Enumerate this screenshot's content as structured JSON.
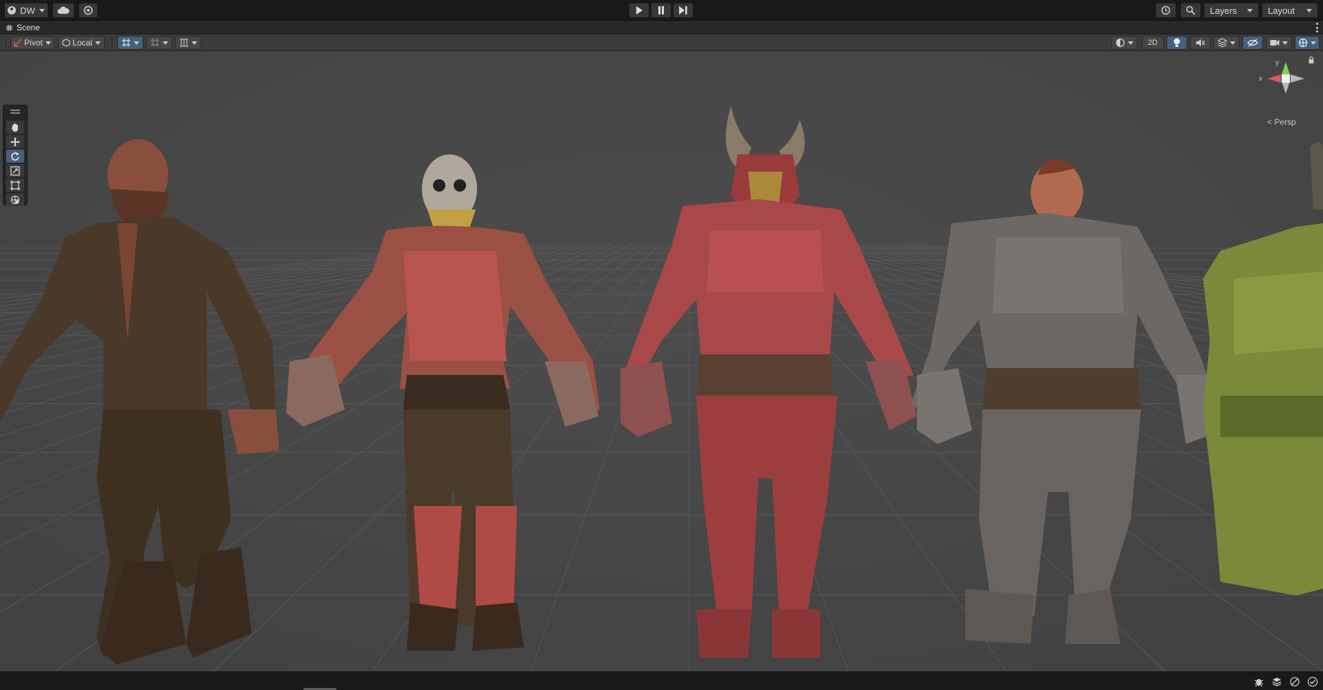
{
  "toolbar": {
    "account_label": "DW",
    "layers_label": "Layers",
    "layout_label": "Layout",
    "icons": [
      "account-icon",
      "cloud-icon",
      "collab-icon",
      "play-icon",
      "pause-icon",
      "step-icon",
      "history-icon",
      "search-icon"
    ]
  },
  "scene_tab": {
    "title": "Scene",
    "menu_icon": "kebab-menu-icon"
  },
  "scene_toolbar": {
    "pivot_label": "Pivot",
    "local_label": "Local",
    "mode_2d_label": "2D",
    "icons": [
      "grid-snap-icon",
      "increment-snap-icon",
      "align-icon",
      "shading-mode-icon",
      "lighting-icon",
      "audio-icon",
      "effects-icon",
      "hidden-objects-icon",
      "camera-icon",
      "gizmos-icon"
    ]
  },
  "tools": [
    "hand-tool-icon",
    "move-tool-icon",
    "rotate-tool-icon",
    "scale-tool-icon",
    "rect-tool-icon",
    "transform-tool-icon"
  ],
  "gizmo": {
    "x_label": "x",
    "y_label": "y",
    "projection_label": "Persp"
  },
  "viewport": {
    "background": "#474747",
    "characters": [
      {
        "name": "bald-bearded-man",
        "outfit": "brown-leather"
      },
      {
        "name": "skull-mask-warrior",
        "outfit": "red-vest-and-leggings"
      },
      {
        "name": "horned-red-knight",
        "outfit": "red-plate-armor"
      },
      {
        "name": "mohawk-grey-knight",
        "outfit": "grey-plate-armor"
      },
      {
        "name": "green-orc-knight",
        "outfit": "green-plate-armor"
      }
    ]
  },
  "status_icons": [
    "debug-icon",
    "stack-icon",
    "hidden-icon",
    "check-icon"
  ],
  "colors": {
    "accent": "#46607c",
    "gizmo_x": "#d85a5a",
    "gizmo_y": "#7fd45a",
    "gizmo_z": "#6a8fd8"
  }
}
